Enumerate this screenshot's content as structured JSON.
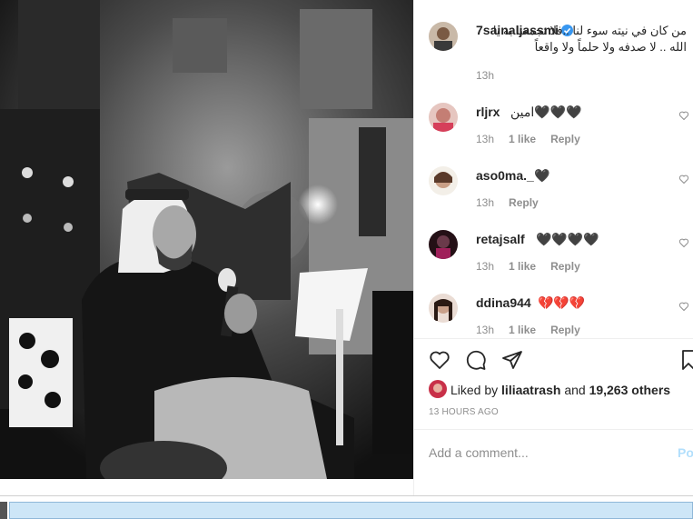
{
  "post": {
    "author": "7sainaljassmi",
    "verified": true,
    "caption": "من كان في نيته سوء لنا ..فلا تجمعنا به يا الله .. لا صدفه ولا حلماً ولا واقعاً",
    "caption_time": "13h"
  },
  "comments": [
    {
      "user": "rljrx",
      "text": "امين🖤🖤🖤",
      "time": "13h",
      "likes": "1 like",
      "reply": "Reply"
    },
    {
      "user": "aso0ma._",
      "text": "🖤",
      "time": "13h",
      "likes": "",
      "reply": "Reply"
    },
    {
      "user": "retajsalf",
      "text": "🖤🖤🖤🖤",
      "time": "13h",
      "likes": "1 like",
      "reply": "Reply"
    },
    {
      "user": "ddina944",
      "text": "💔💔💔",
      "time": "13h",
      "likes": "1 like",
      "reply": "Reply"
    }
  ],
  "likes_bar": {
    "prefix": "Liked by",
    "liker": "liliaatrash",
    "middle": "and",
    "others": "19,263 others"
  },
  "timestamp": "13 HOURS AGO",
  "add_comment": {
    "placeholder": "Add a comment...",
    "post_label": "Post"
  },
  "colors": {
    "text": "#262626",
    "secondary": "#8e8e8e",
    "verified": "#3897f0",
    "post_button": "#b2dffc"
  },
  "icons": [
    "verified-badge-icon",
    "heart-icon",
    "comment-icon",
    "share-icon",
    "bookmark-icon"
  ]
}
